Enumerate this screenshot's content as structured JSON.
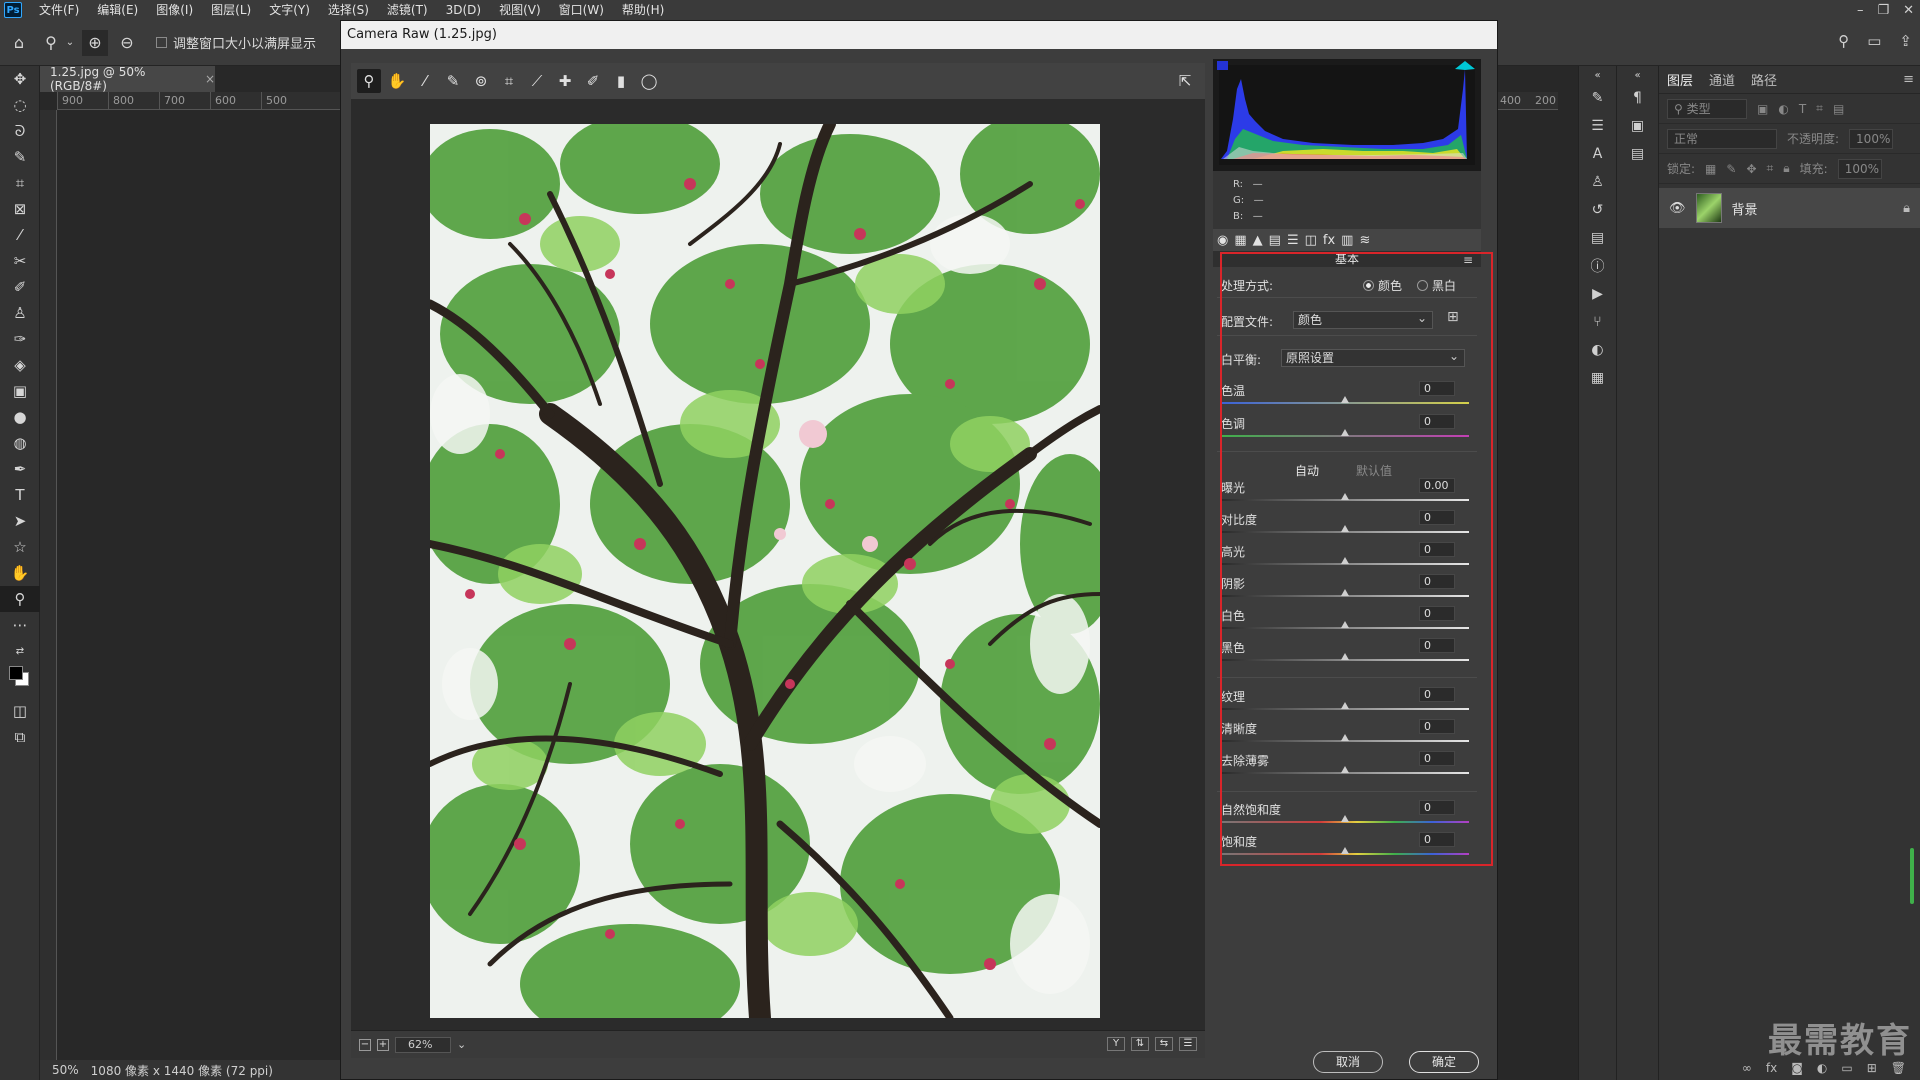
{
  "menubar": {
    "items": [
      "文件(F)",
      "编辑(E)",
      "图像(I)",
      "图层(L)",
      "文字(Y)",
      "选择(S)",
      "滤镜(T)",
      "3D(D)",
      "视图(V)",
      "窗口(W)",
      "帮助(H)"
    ],
    "logo": "Ps"
  },
  "options": {
    "resize_label": "调整窗口大小以满屏显示"
  },
  "document": {
    "tab_title": "1.25.jpg @ 50%(RGB/8#)",
    "ruler_ticks": [
      "900",
      "800",
      "700",
      "600",
      "500"
    ],
    "ruler_ticks_right": [
      "400",
      "200"
    ],
    "status_zoom": "50%",
    "status_size": "1080 像素 x 1440 像素 (72 ppi)"
  },
  "layers_panel": {
    "tabs": [
      "图层",
      "通道",
      "路径"
    ],
    "filter_placeholder": "类型",
    "blend_mode": "正常",
    "opacity_label": "不透明度:",
    "opacity_value": "100%",
    "lock_label": "锁定:",
    "fill_label": "填充:",
    "fill_value": "100%",
    "layer_name": "背景"
  },
  "watermark": "最需教育",
  "camera_raw": {
    "title": "Camera Raw (1.25.jpg)",
    "zoom_value": "62%",
    "rgb": {
      "r_label": "R:",
      "g_label": "G:",
      "b_label": "B:",
      "r": "—",
      "g": "—",
      "b": "—"
    },
    "panel_title": "基本",
    "treatment_label": "处理方式:",
    "treatment_color": "颜色",
    "treatment_bw": "黑白",
    "profile_label": "配置文件:",
    "profile_value": "颜色",
    "wb_label": "白平衡:",
    "wb_value": "原照设置",
    "auto_label": "自动",
    "default_label": "默认值",
    "sliders": [
      {
        "label": "色温",
        "value": "0"
      },
      {
        "label": "色调",
        "value": "0"
      },
      {
        "label": "曝光",
        "value": "0.00"
      },
      {
        "label": "对比度",
        "value": "0"
      },
      {
        "label": "高光",
        "value": "0"
      },
      {
        "label": "阴影",
        "value": "0"
      },
      {
        "label": "白色",
        "value": "0"
      },
      {
        "label": "黑色",
        "value": "0"
      },
      {
        "label": "纹理",
        "value": "0"
      },
      {
        "label": "清晰度",
        "value": "0"
      },
      {
        "label": "去除薄雾",
        "value": "0"
      },
      {
        "label": "自然饱和度",
        "value": "0"
      },
      {
        "label": "饱和度",
        "value": "0"
      }
    ],
    "cancel_label": "取消",
    "ok_label": "确定"
  },
  "colors": {
    "highlight": "#d9252a",
    "accent_green": "#3fb04a"
  }
}
